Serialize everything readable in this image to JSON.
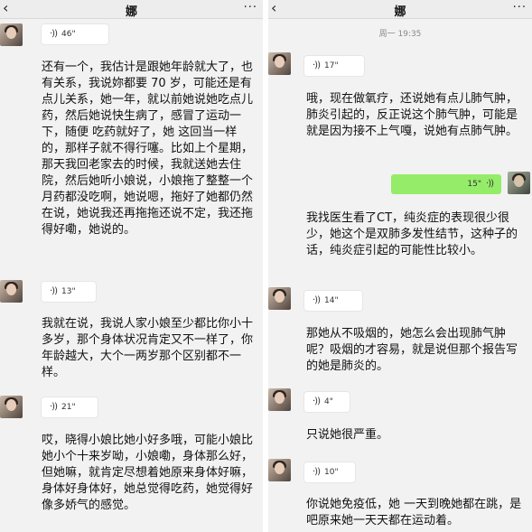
{
  "left": {
    "title": "娜",
    "back_icon": "‹",
    "more_icon": "···",
    "messages": [
      {
        "duration": "46\"",
        "text": "还有一个，我估计是跟她年龄就大了，也有关系，我说妳都要 70 岁，可能还是有点儿关系，她一年，就以前她说她吃点儿药，然后她说快生病了，感冒了运动一下，随便 吃药就好了，她 这回当一样的，那样子就不得行噻。比如上个星期，那天我回老家去的时候，我就送她去住院，然后她听小娘说，小娘拖了整整一个月药都没吃啊，她说嗯，拖好了她都仍然在说，她说我还再拖拖还说不定，我还拖得好嘞，她说的。"
      },
      {
        "duration": "13\"",
        "text": "我就在说，我说人家小娘至少都比你小十多岁，那个身体状况肯定又不一样了，你年龄越大，大个一两岁那个区别都不一样。"
      },
      {
        "duration": "21\"",
        "text": "哎，晓得小娘比她小好多哦，可能小娘比她小个十来岁呦，小娘嘞，身体那么好，但她嘛，就肯定尽想着她原来身体好嘛，身体好身体好，她总觉得吃药，她觉得好像多娇气的感觉。"
      }
    ]
  },
  "right": {
    "title": "娜",
    "back_icon": "‹",
    "more_icon": "···",
    "timestamp": "周一 19:35",
    "messages": [
      {
        "duration": "17\"",
        "text": "哦，现在做氧疗，还说她有点儿肺气肿，肺炎引起的，反正说这个肺气肿，可能是就是因为接不上气嘎，说她有点肺气肿。"
      },
      {
        "duration": "15\"",
        "outgoing": true,
        "text": "我找医生看了CT，纯炎症的表现很少很少，她这个是双肺多发性结节，这种子的话，纯炎症引起的可能性比较小。"
      },
      {
        "duration": "14\"",
        "text": "那她从不吸烟的，她怎么会出现肺气肿呢？吸烟的才容易，就是说但那个报告写的她是肺炎的。"
      },
      {
        "duration": "4\"",
        "text": "只说她很严重。"
      },
      {
        "duration": "10\"",
        "text": "你说她免疫低，她 一天到晚她都在跳，是吧原来她一天天都在运动着。"
      }
    ]
  },
  "icons": {
    "voice_in": "voice-wave-icon",
    "voice_out": "voice-wave-icon",
    "wave_glyph": "·))"
  },
  "colors": {
    "outgoing_bubble": "#95ec69",
    "background": "#f2f2f2",
    "header": "#ededed"
  }
}
